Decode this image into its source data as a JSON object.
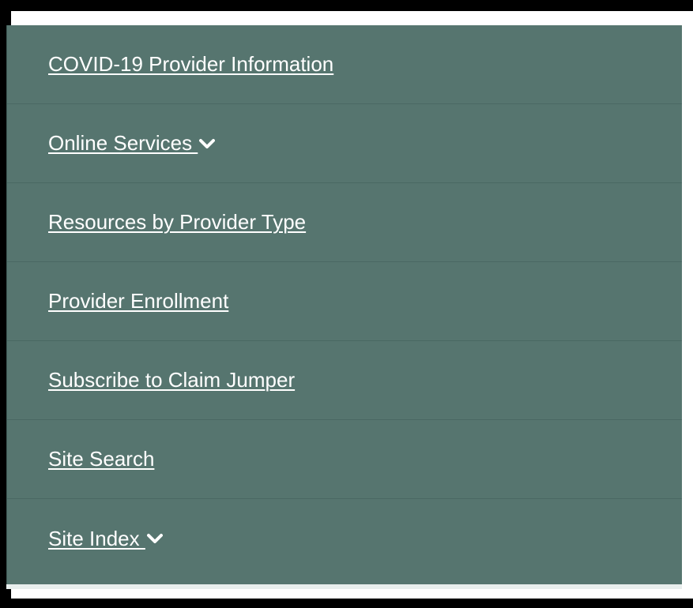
{
  "menu": {
    "items": [
      {
        "label": "COVID-19 Provider Information",
        "has_dropdown": false
      },
      {
        "label": "Online Services ",
        "has_dropdown": true
      },
      {
        "label": "Resources by Provider Type",
        "has_dropdown": false
      },
      {
        "label": "Provider Enrollment",
        "has_dropdown": false
      },
      {
        "label": "Subscribe to Claim Jumper",
        "has_dropdown": false
      },
      {
        "label": "Site Search",
        "has_dropdown": false
      },
      {
        "label": "Site Index ",
        "has_dropdown": true
      }
    ]
  },
  "colors": {
    "menu_background": "#56756f",
    "link_text": "#ffffff",
    "frame_border": "#000000"
  },
  "icons": {
    "dropdown": "chevron-down-icon"
  }
}
